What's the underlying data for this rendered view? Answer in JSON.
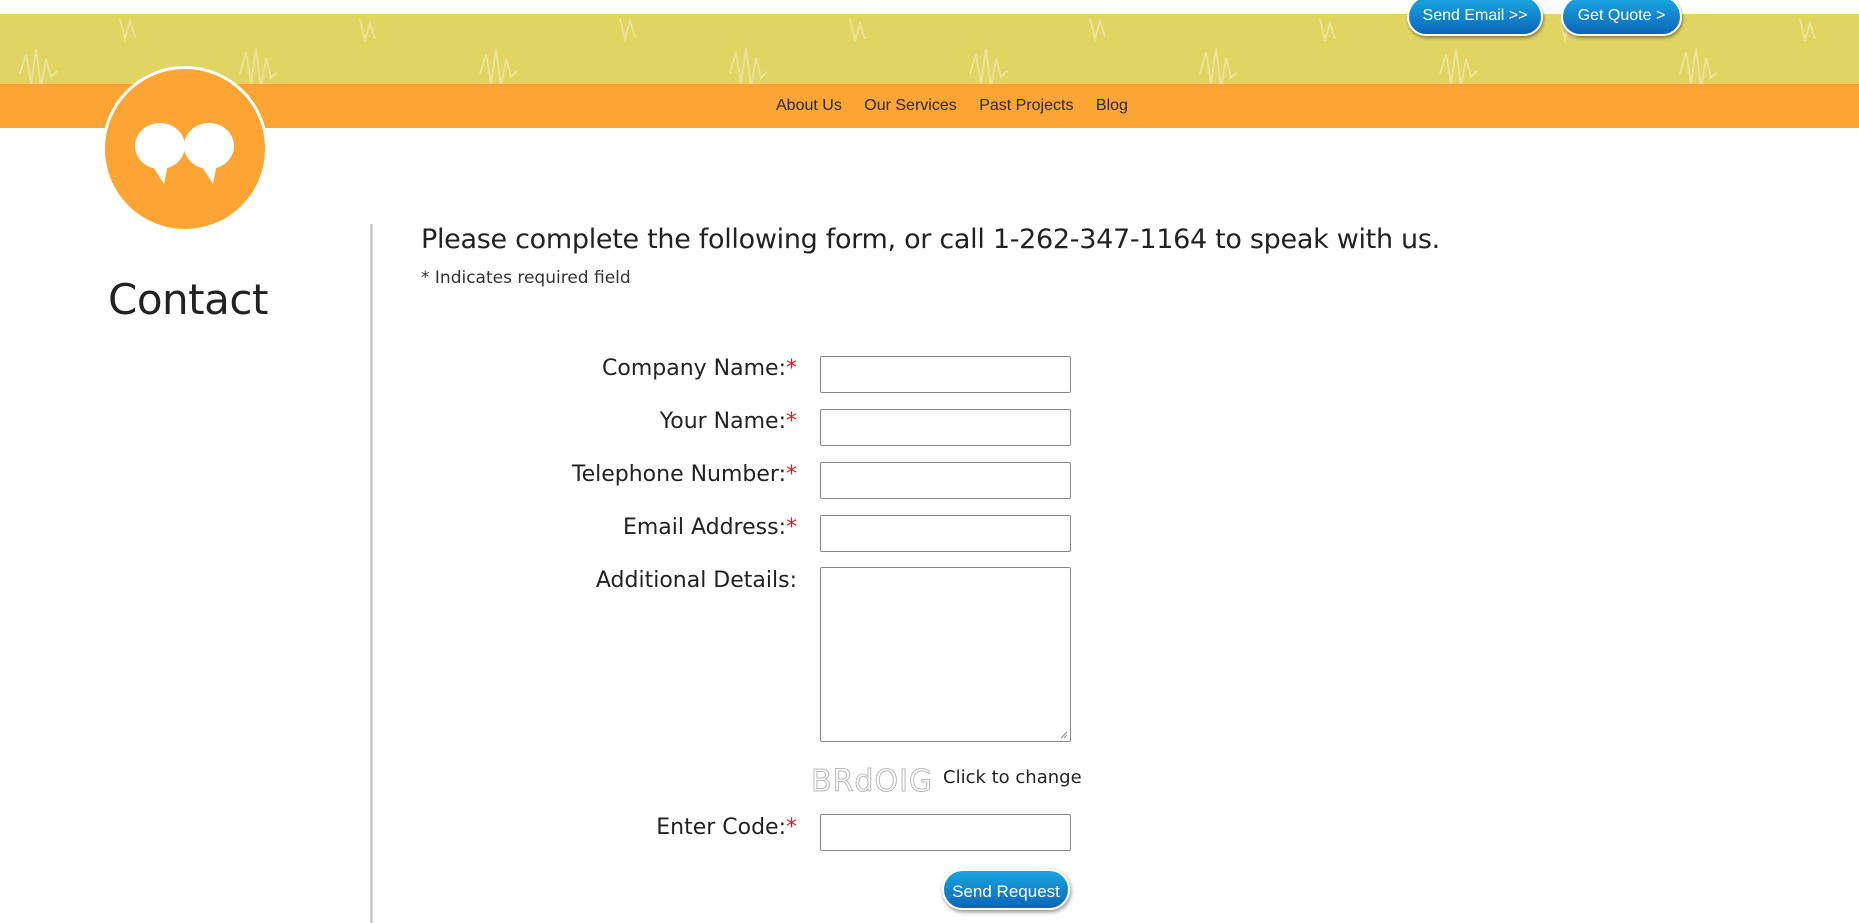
{
  "header": {
    "send_email": "Send Email >>",
    "get_quote": "Get Quote >"
  },
  "nav": {
    "items": [
      "About Us",
      "Our Services",
      "Past Projects",
      "Blog"
    ]
  },
  "page": {
    "title": "Contact",
    "intro": "Please complete the following form, or call 1-262-347-1164 to speak with us.",
    "required_note": "* Indicates required field"
  },
  "form": {
    "company_label": "Company Name:",
    "name_label": "Your Name:",
    "phone_label": "Telephone Number:",
    "email_label": "Email Address:",
    "details_label": "Additional Details:",
    "code_label": "Enter Code:",
    "required_mark": "*",
    "captcha_text": "BRdOIG",
    "captcha_change": "Click to change",
    "submit": "Send Request"
  },
  "colors": {
    "banner_yellow": "#e0d462",
    "nav_orange": "#fca534",
    "button_blue": "#0a66b8",
    "required_red": "#d91f1f"
  },
  "icons": {
    "logo": "quote-marks-icon"
  }
}
